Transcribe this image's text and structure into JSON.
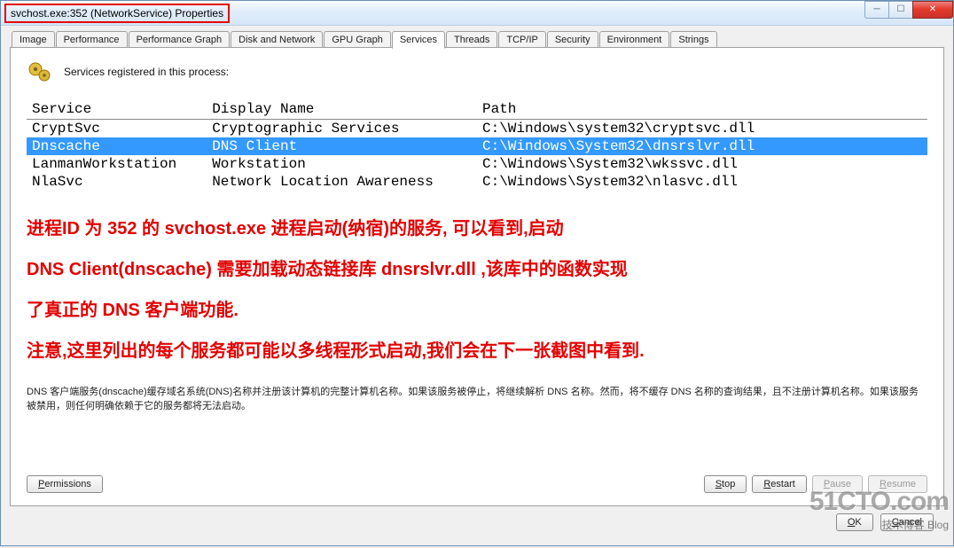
{
  "window": {
    "title": "svchost.exe:352 (NetworkService) Properties"
  },
  "tabs": [
    "Image",
    "Performance",
    "Performance Graph",
    "Disk and Network",
    "GPU Graph",
    "Services",
    "Threads",
    "TCP/IP",
    "Security",
    "Environment",
    "Strings"
  ],
  "active_tab_index": 5,
  "panel": {
    "header": "Services registered in this process:",
    "columns": {
      "service": "Service",
      "display": "Display Name",
      "path": "Path"
    },
    "rows": [
      {
        "service": "CryptSvc",
        "display": "Cryptographic Services",
        "path": "C:\\Windows\\system32\\cryptsvc.dll",
        "selected": false
      },
      {
        "service": "Dnscache",
        "display": "DNS Client",
        "path": "C:\\Windows\\System32\\dnsrslvr.dll",
        "selected": true
      },
      {
        "service": "LanmanWorkstation",
        "display": "Workstation",
        "path": "C:\\Windows\\System32\\wkssvc.dll",
        "selected": false
      },
      {
        "service": "NlaSvc",
        "display": "Network Location Awareness",
        "path": "C:\\Windows\\System32\\nlasvc.dll",
        "selected": false
      }
    ]
  },
  "annotation": {
    "line1": "进程ID 为 352 的 svchost.exe 进程启动(纳宿)的服务, 可以看到,启动",
    "line2": "DNS Client(dnscache) 需要加载动态链接库 dnsrslvr.dll ,该库中的函数实现",
    "line3": "了真正的 DNS 客户端功能.",
    "line4": "注意,这里列出的每个服务都可能以多线程形式启动,我们会在下一张截图中看到."
  },
  "description": "DNS 客户端服务(dnscache)缓存域名系统(DNS)名称并注册该计算机的完整计算机名称。如果该服务被停止，将继续解析 DNS 名称。然而，将不缓存 DNS 名称的查询结果，且不注册计算机名称。如果该服务被禁用，则任何明确依赖于它的服务都将无法启动。",
  "buttons": {
    "permissions": "Permissions",
    "stop": "Stop",
    "restart": "Restart",
    "pause": "Pause",
    "resume": "Resume",
    "ok": "OK",
    "cancel": "Cancel"
  },
  "watermark": {
    "big": "51CTO.com",
    "small": "技术博客 Blog"
  }
}
